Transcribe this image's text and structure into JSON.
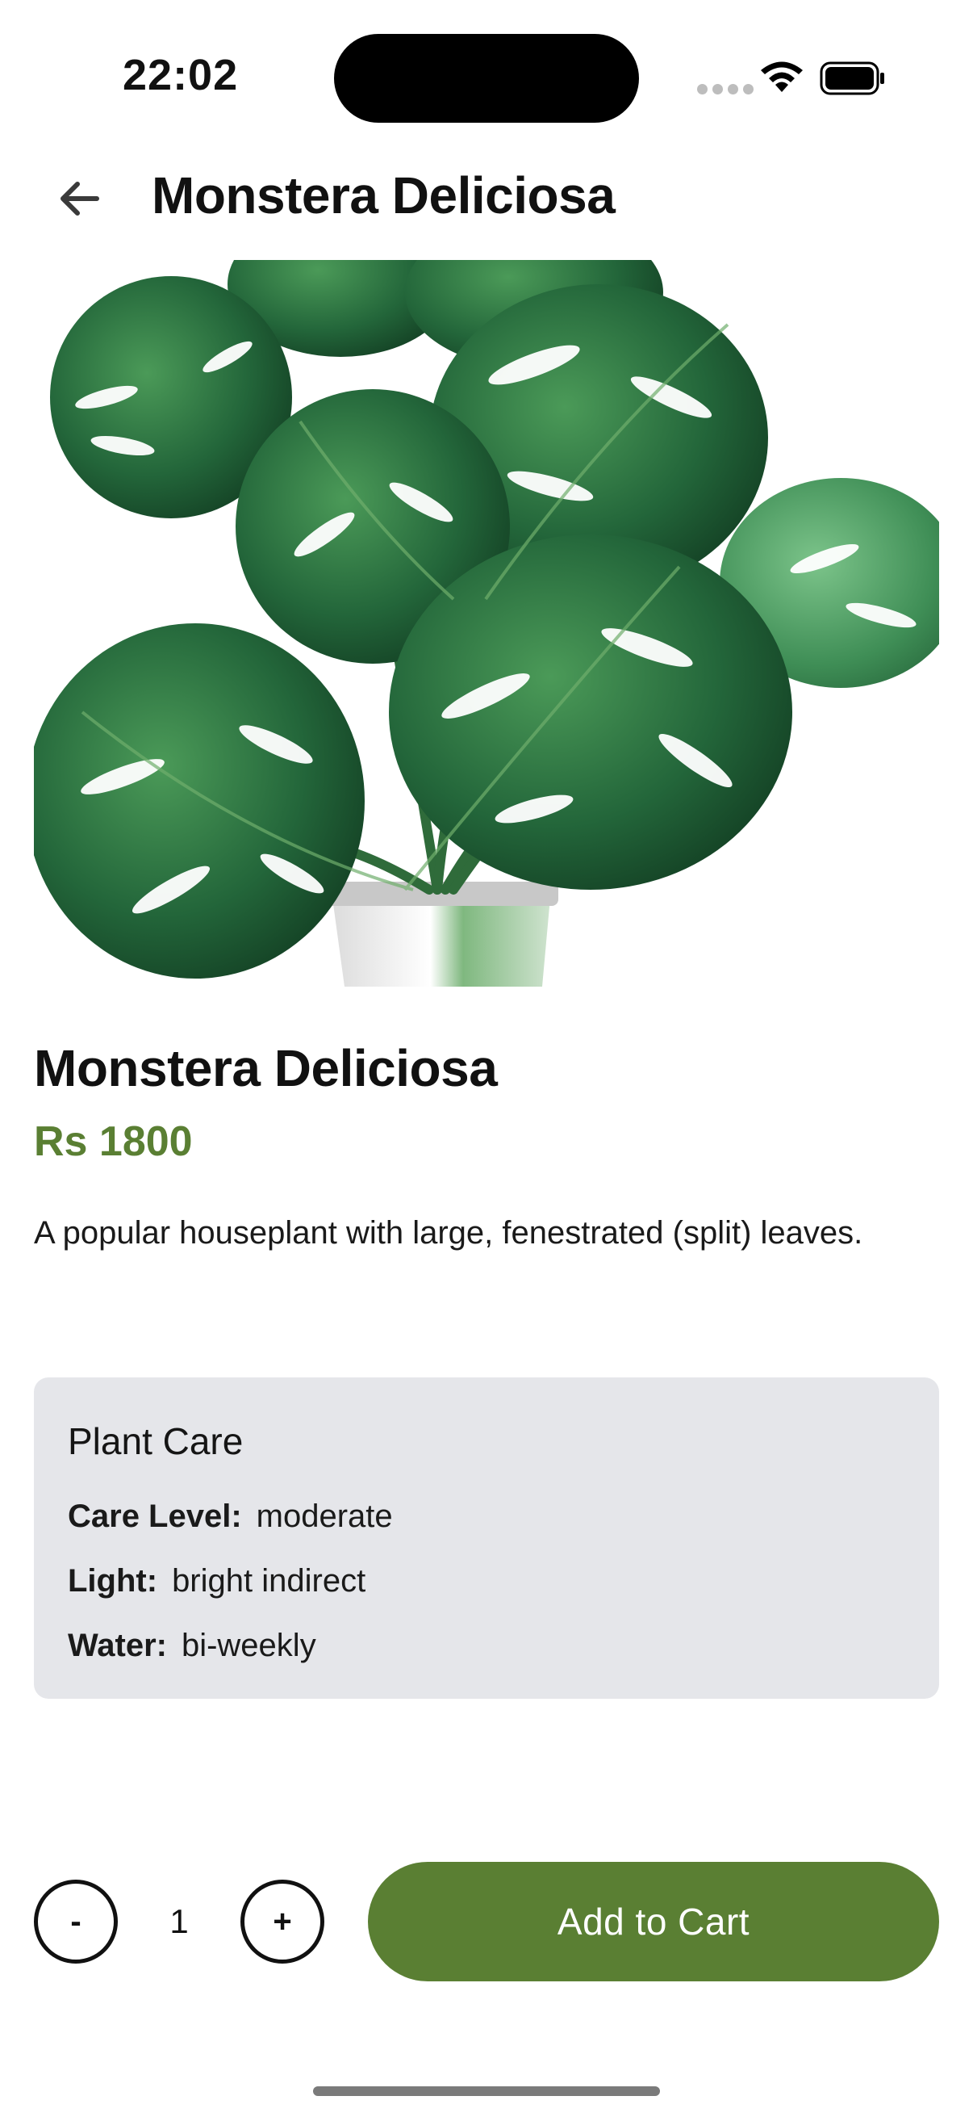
{
  "status_bar": {
    "time": "22:02"
  },
  "header": {
    "title": "Monstera Deliciosa",
    "back_icon": "arrow-left-icon"
  },
  "product": {
    "image_icon": "monstera-plant-image",
    "name": "Monstera Deliciosa",
    "price": "Rs 1800",
    "description": "A popular houseplant with large, fenestrated (split) leaves."
  },
  "care": {
    "title": "Plant Care",
    "rows": [
      {
        "label": "Care Level:",
        "value": "moderate"
      },
      {
        "label": "Light:",
        "value": "bright indirect"
      },
      {
        "label": "Water:",
        "value": "bi-weekly"
      }
    ]
  },
  "cart": {
    "minus_label": "-",
    "quantity": "1",
    "plus_label": "+",
    "add_label": "Add to Cart"
  },
  "colors": {
    "accent": "#5a7f33",
    "card_bg": "#e5e6ea",
    "leaf_dark": "#1f5a2c",
    "leaf_light": "#3c8a4c"
  }
}
